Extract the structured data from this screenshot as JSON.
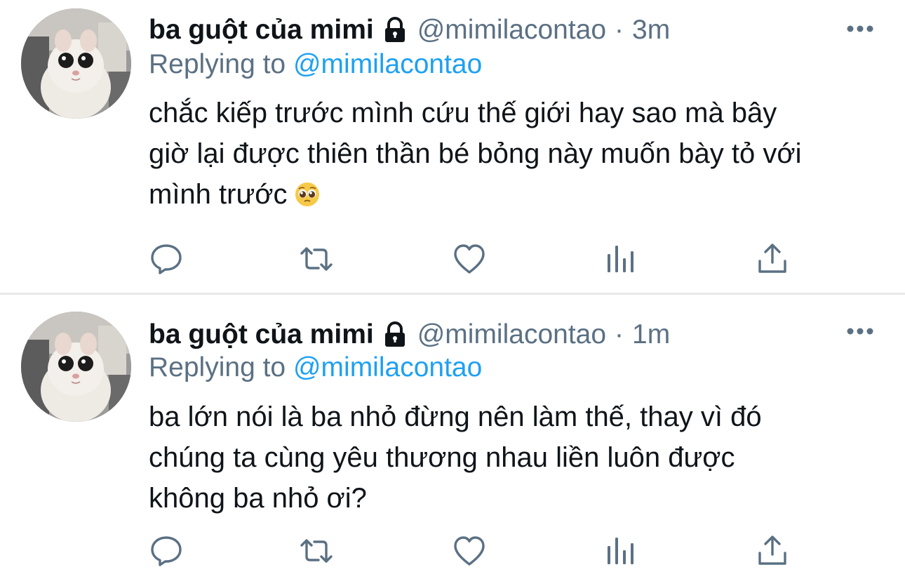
{
  "tweets": [
    {
      "display_name": "ba guột của mimi",
      "handle": "@mimilacontao",
      "separator": "·",
      "time": "3m",
      "replying_prefix": "Replying to",
      "replying_to": "@mimilacontao",
      "body_lines": [
        "chắc kiếp trước mình cứu thế giới hay sao mà bây",
        "giờ lại được thiên thần bé bỏng này muốn bày tỏ với",
        "mình trước"
      ],
      "emoji": "pleading-face-emoji"
    },
    {
      "display_name": "ba guột của mimi",
      "handle": "@mimilacontao",
      "separator": "·",
      "time": "1m",
      "replying_prefix": "Replying to",
      "replying_to": "@mimilacontao",
      "body_lines": [
        "ba lớn nói là ba nhỏ đừng nên làm thế, thay vì đó",
        "chúng ta cùng yêu thương nhau liền luôn được",
        "không ba nhỏ ơi?"
      ]
    }
  ],
  "icons": {
    "protected": "lock-icon",
    "more": "more-icon",
    "actions": [
      "reply-icon",
      "retweet-icon",
      "like-icon",
      "analytics-icon",
      "share-icon"
    ]
  },
  "colors": {
    "text_primary": "#0f1419",
    "text_secondary": "#5b7083",
    "link": "#1da1f2",
    "divider": "#e6e8ea"
  }
}
